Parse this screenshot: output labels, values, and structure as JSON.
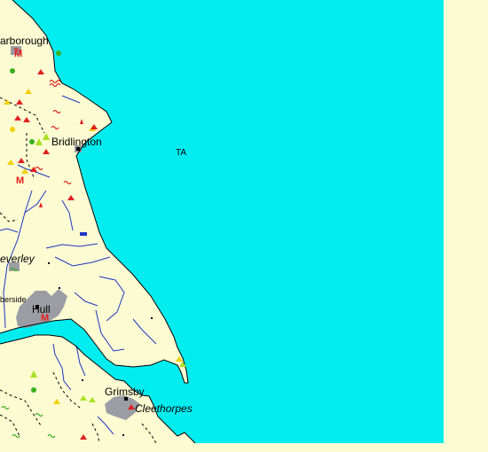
{
  "map": {
    "grid_square": "TA",
    "colors": {
      "sea": "#00edf0",
      "land": "#fdfbd2",
      "urban": "#9c9ca4",
      "river": "#1f35c4",
      "boundary": "#000000",
      "label": "#000000"
    },
    "places": [
      {
        "id": "scarborough",
        "label": "arborough",
        "style": "normal"
      },
      {
        "id": "bridlington",
        "label": "Bridlington",
        "style": "normal"
      },
      {
        "id": "beverley",
        "label": "everley",
        "style": "italic"
      },
      {
        "id": "humberside",
        "label": "berside",
        "style": "small"
      },
      {
        "id": "hull",
        "label": "Hull",
        "style": "normal"
      },
      {
        "id": "grimsby",
        "label": "Grimsby",
        "style": "normal"
      },
      {
        "id": "cleethorpes",
        "label": "Cleethorpes",
        "style": "italic"
      }
    ],
    "symbols": {
      "motorway_marker": "M",
      "tourist_icons": [
        "campsite-icon",
        "caravan-icon",
        "golf-icon",
        "viewpoint-icon",
        "picnic-icon"
      ]
    }
  }
}
